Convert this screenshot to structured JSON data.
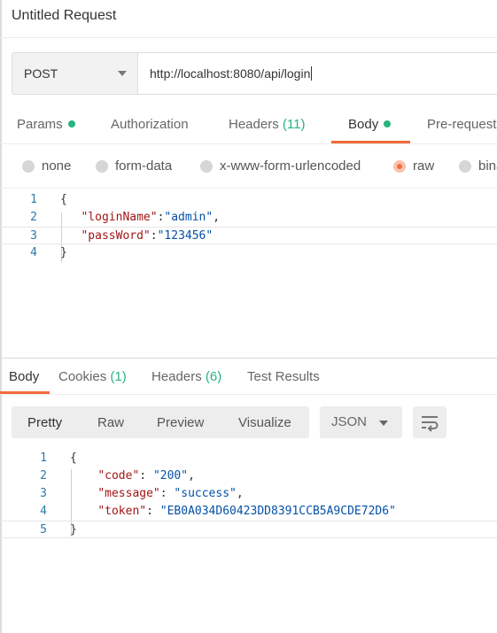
{
  "request": {
    "title": "Untitled Request",
    "method": "POST",
    "url": "http://localhost:8080/api/login"
  },
  "request_tabs": [
    {
      "label": "Params",
      "dot": true
    },
    {
      "label": "Authorization"
    },
    {
      "label": "Headers",
      "count": "(11)"
    },
    {
      "label": "Body",
      "dot": true,
      "active": true
    },
    {
      "label": "Pre-request"
    }
  ],
  "body_types": [
    {
      "label": "none"
    },
    {
      "label": "form-data"
    },
    {
      "label": "x-www-form-urlencoded"
    },
    {
      "label": "raw",
      "selected": true
    },
    {
      "label": "binary"
    }
  ],
  "request_body": {
    "line_numbers": [
      "1",
      "2",
      "3",
      "4"
    ],
    "open_brace": "{",
    "key1": "\"loginName\"",
    "val1": "\"admin\"",
    "key2": "\"passWord\"",
    "val2": "\"123456\"",
    "close_brace": "}"
  },
  "response_tabs": [
    {
      "label": "Body",
      "active": true
    },
    {
      "label": "Cookies",
      "count": "(1)"
    },
    {
      "label": "Headers",
      "count": "(6)"
    },
    {
      "label": "Test Results"
    }
  ],
  "view_modes": [
    "Pretty",
    "Raw",
    "Preview",
    "Visualize"
  ],
  "format": "JSON",
  "response_body": {
    "line_numbers": [
      "1",
      "2",
      "3",
      "4",
      "5"
    ],
    "open_brace": "{",
    "k_code": "\"code\"",
    "v_code": "\"200\"",
    "k_message": "\"message\"",
    "v_message": "\"success\"",
    "k_token": "\"token\"",
    "v_token": "\"EB0A034D60423DD8391CCB5A9CDE72D6\"",
    "close_brace": "}"
  },
  "colors": {
    "accent": "#f26b3a",
    "status_green": "#26b47f",
    "json_key": "#a31515",
    "json_string": "#0451a5",
    "line_number": "#2b7aa6"
  },
  "icons": [
    "chevron-down-icon",
    "wrap-lines-icon",
    "radio-icon"
  ]
}
